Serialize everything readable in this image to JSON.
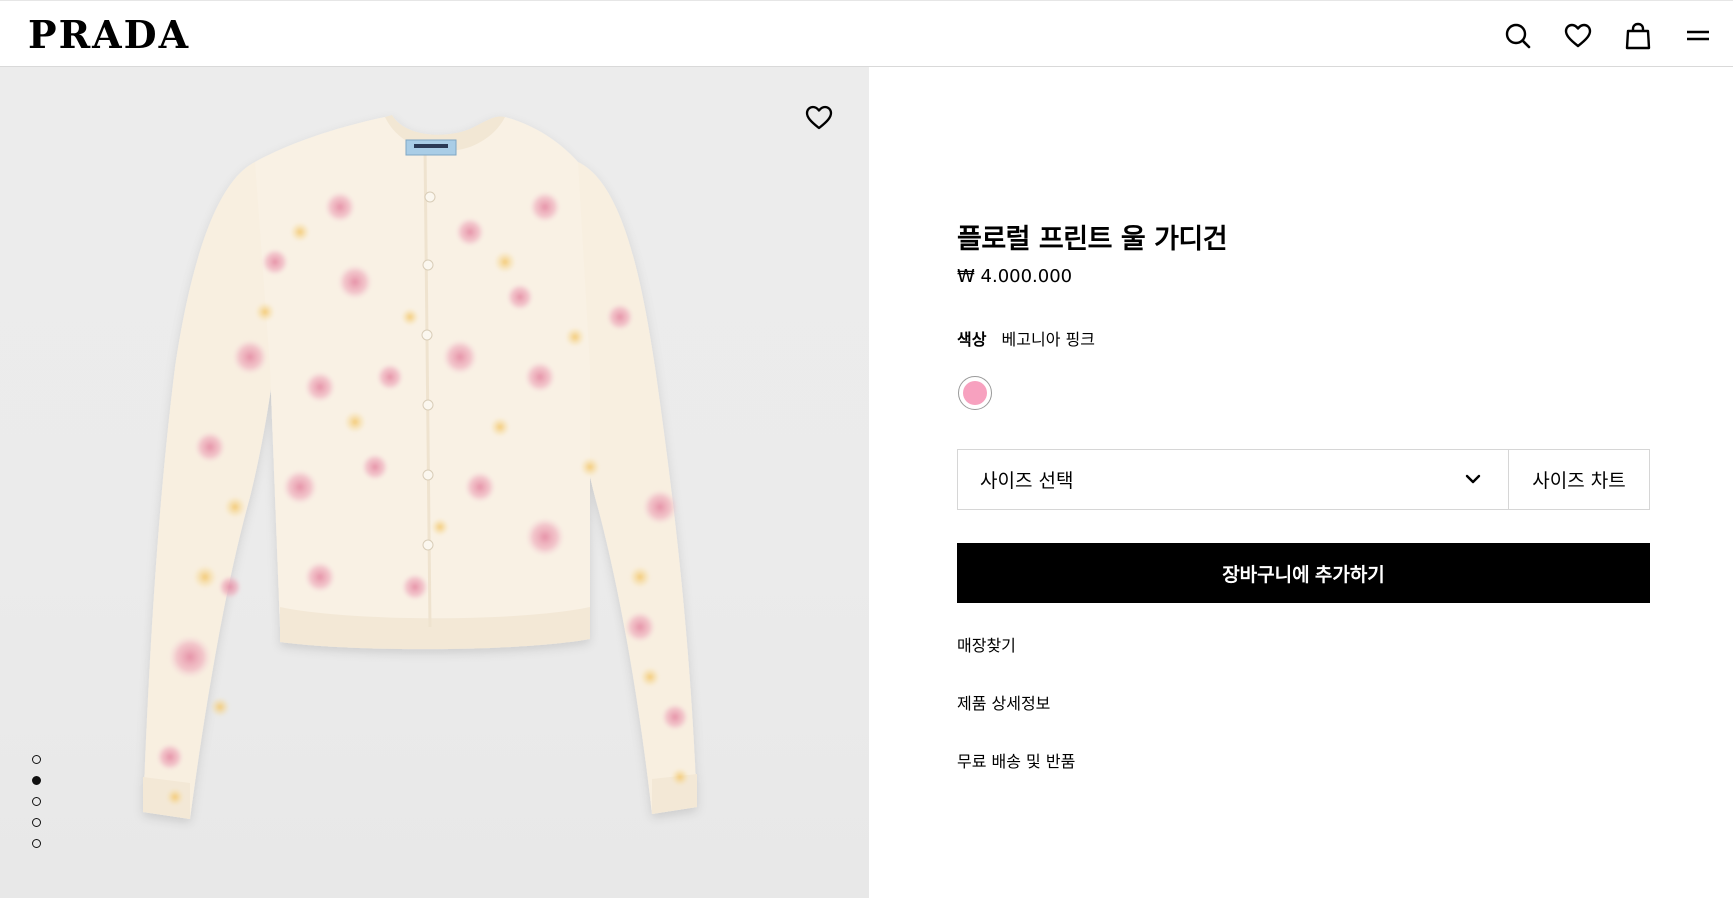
{
  "header": {
    "logo": "PRADA",
    "icons": [
      "search-icon",
      "heart-icon",
      "bag-icon",
      "menu-icon"
    ]
  },
  "gallery": {
    "image_description_icon": "cardigan-image",
    "dots_total": 5,
    "active_dot": 2
  },
  "product": {
    "title": "플로럴 프린트 울 가디건",
    "price": "₩ 4.000.000",
    "color_label": "색상",
    "color_value": "베고니아 핑크",
    "swatch_color": "#f7a1bf"
  },
  "size": {
    "select_label": "사이즈 선택",
    "chart_label": "사이즈 차트"
  },
  "actions": {
    "add_to_cart": "장바구니에 추가하기"
  },
  "links": [
    "매장찾기",
    "제품 상세정보",
    "무료 배송 및 반품"
  ]
}
